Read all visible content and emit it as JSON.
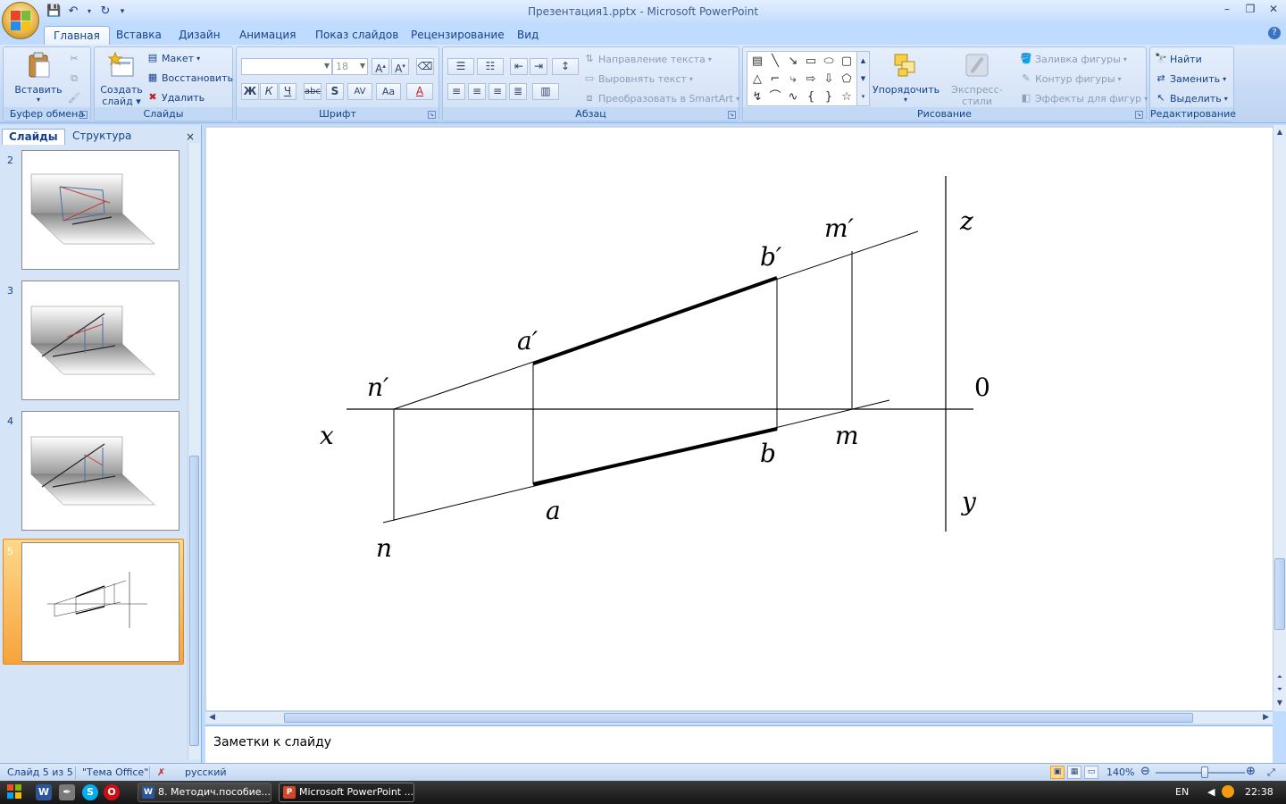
{
  "window": {
    "title": "Презентация1.pptx - Microsoft PowerPoint"
  },
  "qat": {
    "save": "save-icon",
    "undo": "undo-icon",
    "redo": "redo-icon",
    "customize": "▾"
  },
  "tabs": [
    {
      "label": "Главная",
      "active": true
    },
    {
      "label": "Вставка"
    },
    {
      "label": "Дизайн"
    },
    {
      "label": "Анимация"
    },
    {
      "label": "Показ слайдов"
    },
    {
      "label": "Рецензирование"
    },
    {
      "label": "Вид"
    }
  ],
  "ribbon": {
    "clipboard": {
      "label": "Буфер обмена",
      "paste": "Вставить"
    },
    "slides": {
      "label": "Слайды",
      "new_slide_1": "Создать",
      "new_slide_2": "слайд",
      "layout": "Макет",
      "reset": "Восстановить",
      "delete": "Удалить"
    },
    "font": {
      "label": "Шрифт",
      "font_name": "",
      "font_size": "18",
      "bold": "Ж",
      "italic": "К",
      "underline": "Ч",
      "strike": "abc",
      "shadow": "S",
      "spacing": "AV",
      "case": "Aa",
      "color": "A"
    },
    "paragraph": {
      "label": "Абзац",
      "text_direction": "Направление текста",
      "align_text": "Выровнять текст",
      "smartart": "Преобразовать в SmartArt"
    },
    "drawing": {
      "label": "Рисование",
      "arrange": "Упорядочить",
      "quick_styles": "Экспресс-стили",
      "fill": "Заливка фигуры",
      "outline": "Контур фигуры",
      "effects": "Эффекты для фигур"
    },
    "editing": {
      "label": "Редактирование",
      "find": "Найти",
      "replace": "Заменить",
      "select": "Выделить"
    }
  },
  "left_pane": {
    "tab_slides": "Слайды",
    "tab_outline": "Структура",
    "close": "×",
    "slides": [
      {
        "number": "2"
      },
      {
        "number": "3"
      },
      {
        "number": "4"
      },
      {
        "number": "5",
        "selected": true
      }
    ]
  },
  "slide": {
    "labels": {
      "z": "z",
      "m_prime": "m′",
      "b_prime": "b′",
      "a_prime": "a′",
      "n_prime": "n′",
      "zero": "0",
      "x": "x",
      "m": "m",
      "b": "b",
      "y": "y",
      "a": "a",
      "n": "n"
    }
  },
  "notes": {
    "placeholder": "Заметки к слайду"
  },
  "status": {
    "slide_info": "Слайд 5 из 5",
    "theme": "\"Тема Office\"",
    "language": "русский",
    "zoom": "140%",
    "zoom_fraction": 0.55
  },
  "taskbar": {
    "tasks": [
      {
        "label": "8. Методич.пособие...",
        "icon": "W"
      },
      {
        "label": "Microsoft PowerPoint ...",
        "icon": "P",
        "active": true
      }
    ],
    "lang": "EN",
    "time": "22:38"
  },
  "colors": {
    "ribbon_bg": "#c7daf5",
    "selected_thumb": "#f7a33c",
    "text_blue": "#15428b"
  }
}
